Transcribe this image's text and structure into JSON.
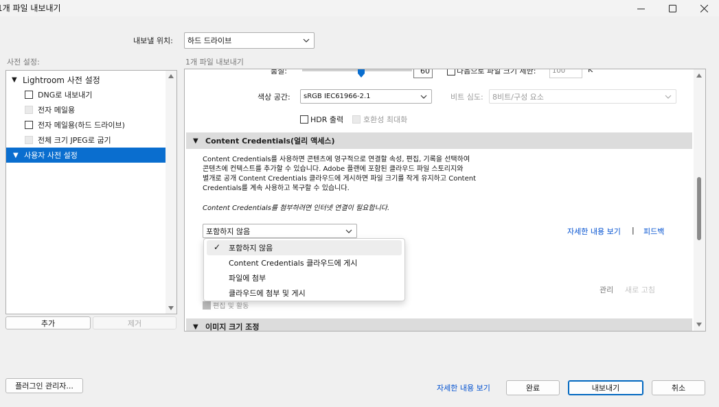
{
  "window": {
    "title": "1개 파일 내보내기"
  },
  "export_location": {
    "label": "내보낼 위치:",
    "value": "하드 드라이브"
  },
  "presets": {
    "label": "사전 설정:",
    "items": [
      {
        "label": "Lightroom 사전 설정",
        "type": "group"
      },
      {
        "label": "DNG로 내보내기",
        "type": "item",
        "enabled": true
      },
      {
        "label": "전자 메일용",
        "type": "item",
        "enabled": false
      },
      {
        "label": "전자 메일용(하드 드라이브)",
        "type": "item",
        "enabled": true
      },
      {
        "label": "전체 크기 JPEG로 굽기",
        "type": "item",
        "enabled": false
      },
      {
        "label": "사용자 사전 설정",
        "type": "group",
        "selected": true
      }
    ],
    "add_button": "추가",
    "remove_button": "제거"
  },
  "settings": {
    "subtitle": "1개 파일 내보내기",
    "quality_label": "품질:",
    "quality_value": "60",
    "limit_file_size_label": "다음으로 파일 크기 제한:",
    "limit_file_size_value": "100",
    "limit_file_size_unit": "K",
    "color_space_label": "색상 공간:",
    "color_space_value": "sRGB IEC61966-2.1",
    "bit_depth_label": "비트 심도:",
    "bit_depth_value": "8비트/구성 요소",
    "hdr_output_label": "HDR 출력",
    "maximize_compat_label": "호환성 최대화",
    "content_credentials": {
      "header": "Content Credentials(얼리 액세스)",
      "description_lines": [
        "Content Credentials를 사용하면 콘텐츠에 영구적으로 연결할 속성, 편집, 기록을 선택하여",
        "콘텐츠에 컨텍스트를 추가할 수 있습니다. Adobe 플랜에 포함된 클라우드 파일 스토리지와",
        "별개로 공개 Content Credentials 클라우드에 게시하면 파일 크기를 작게 유지하고 Content",
        "Credentials를 계속 사용하고 복구할 수 있습니다."
      ],
      "internet_note": "Content Credentials를 첨부하려면 인터넷 연결이 필요합니다.",
      "dropdown_value": "포함하지 않음",
      "dropdown_options": [
        {
          "label": "포함하지 않음",
          "checked": true
        },
        {
          "label": "Content Credentials 클라우드에 게시",
          "checked": false
        },
        {
          "label": "파일에 첨부",
          "checked": false
        },
        {
          "label": "클라우드에 첨부 및 게시",
          "checked": false
        }
      ],
      "learn_more_link": "자세한 내용 보기",
      "separator": "|",
      "feedback_link": "피드백",
      "manage_label": "관리",
      "refresh_label": "새로 고침",
      "edits_activity_label": "편집 및 활동"
    },
    "image_sizing_header": "이미지 크기 조정"
  },
  "footer": {
    "plugin_manager_button": "플러그인 관리자...",
    "learn_more_link": "자세한 내용 보기",
    "done_button": "완료",
    "export_button": "내보내기",
    "cancel_button": "취소"
  },
  "colors": {
    "accent": "#0a6ecf",
    "link": "#0050d0",
    "section_header": "#dcdcdc"
  }
}
